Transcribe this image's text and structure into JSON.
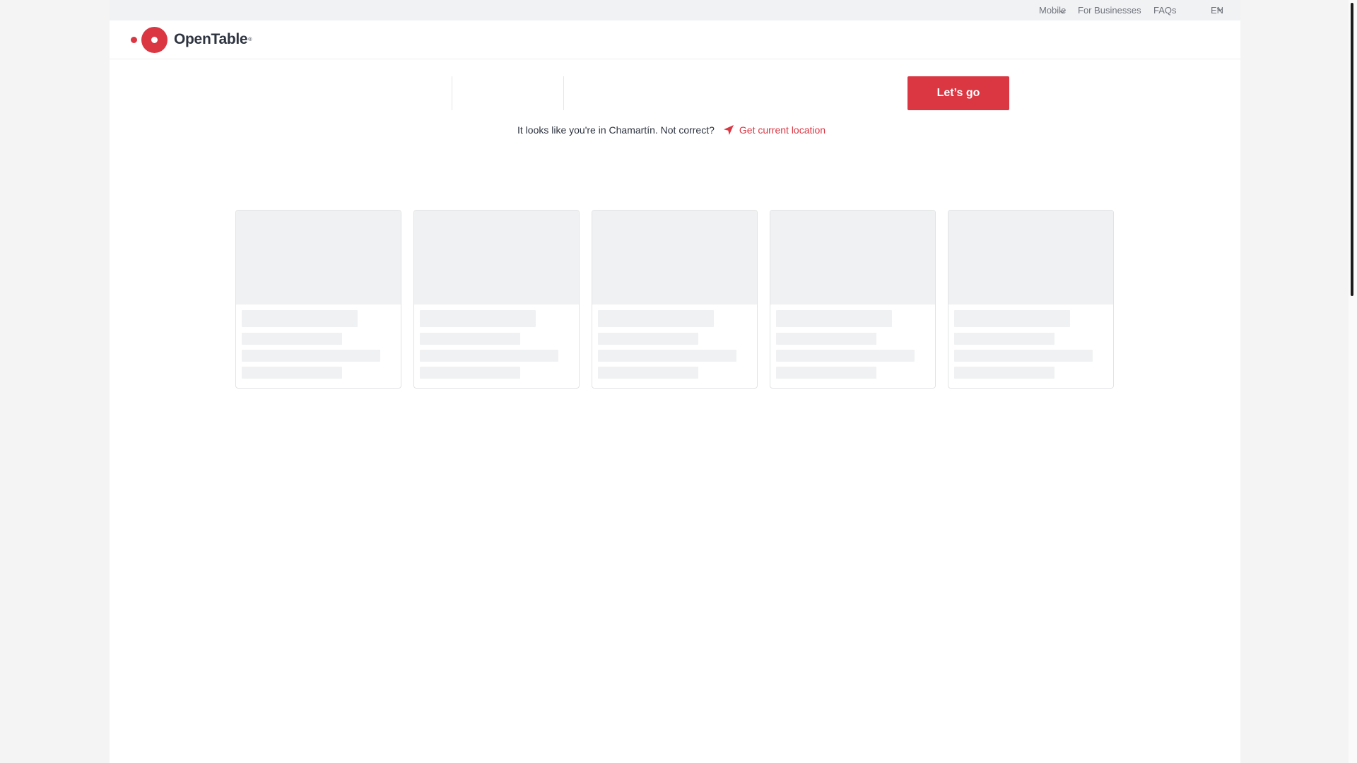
{
  "utility_bar": {
    "links": {
      "mobile": "Mobile",
      "for_businesses": "For Businesses",
      "faqs": "FAQs",
      "language": "EN"
    }
  },
  "header": {
    "logo_text": "OpenTable",
    "logo_reg": "®"
  },
  "search": {
    "submit_label": "Let’s go",
    "location_prompt": "It looks like you're in Chamartín. Not correct?",
    "current_location_label": "Get current location"
  },
  "colors": {
    "brand_red": "#da3743",
    "text_dark": "#2d333f",
    "text_muted": "#6f737b",
    "skeleton": "#f0f1f2"
  },
  "icons": {
    "navigation": "navigation-arrow-icon",
    "chevron": "chevron-down-icon",
    "logo": "opentable-logo-icon"
  },
  "loading_cards_count": 5
}
